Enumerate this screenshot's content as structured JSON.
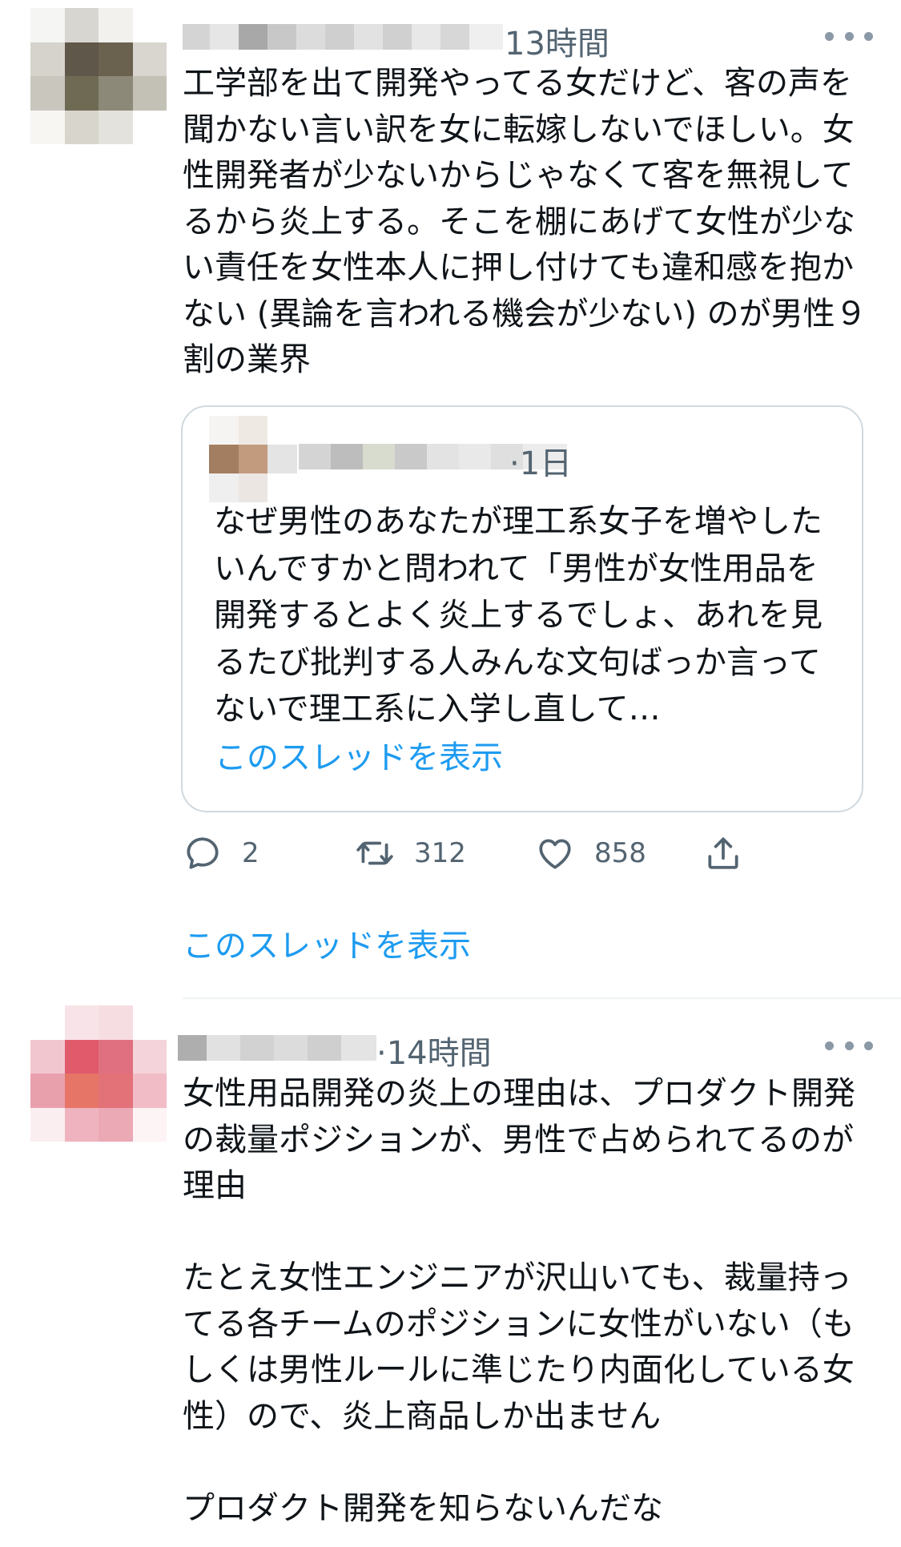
{
  "tweet1": {
    "timestamp": "13時間",
    "text": "工学部を出て開発やってる女だけど、客の声を聞かない言い訳を女に転嫁しないでほしい。女性開発者が少ないからじゃなくて客を無視してるから炎上する。そこを棚にあげて女性が少ない責任を女性本人に押し付けても違和感を抱かない (異論を言われる機会が少ない) のが男性９割の業界",
    "quote": {
      "timestamp": "·1日",
      "text": "なぜ男性のあなたが理工系女子を増やしたいんですかと問われて「男性が女性用品を開発するとよく炎上するでしょ、あれを見るたび批判する人みんな文句ばっか言ってないで理工系に入学し直して…",
      "show_thread": "このスレッドを表示"
    },
    "actions": {
      "reply_count": "2",
      "retweet_count": "312",
      "like_count": "858"
    },
    "show_thread": "このスレッドを表示"
  },
  "tweet2": {
    "timestamp": "·14時間",
    "text": "女性用品開発の炎上の理由は、プロダクト開発の裁量ポジションが、男性で占められてるのが理由\n\nたとえ女性エンジニアが沢山いても、裁量持ってる各チームのポジションに女性がいない（もしくは男性ルールに準じたり内面化している女性）ので、炎上商品しか出ません\n\nプロダクト開発を知らないんだな"
  },
  "icons": {
    "more": "more-horizontal-icon",
    "reply": "reply-icon",
    "retweet": "retweet-icon",
    "like": "heart-icon",
    "share": "share-icon"
  },
  "colors": {
    "link": "#1d9bf0",
    "secondary_text": "#536471",
    "border": "#cfd9de"
  }
}
